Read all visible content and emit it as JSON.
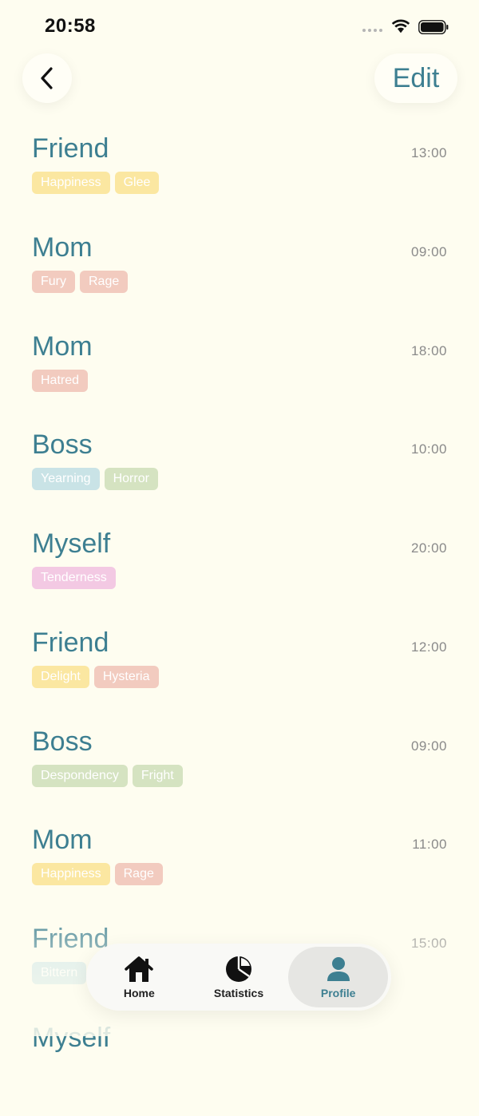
{
  "status_bar": {
    "time": "20:58"
  },
  "header": {
    "back_icon": "chevron-left-icon",
    "edit_label": "Edit"
  },
  "entries": [
    {
      "name": "Friend",
      "time": "13:00",
      "tags": [
        {
          "label": "Happiness",
          "color": "yellow"
        },
        {
          "label": "Glee",
          "color": "yellow"
        }
      ]
    },
    {
      "name": "Mom",
      "time": "09:00",
      "tags": [
        {
          "label": "Fury",
          "color": "red"
        },
        {
          "label": "Rage",
          "color": "red"
        }
      ]
    },
    {
      "name": "Mom",
      "time": "18:00",
      "tags": [
        {
          "label": "Hatred",
          "color": "red"
        }
      ]
    },
    {
      "name": "Boss",
      "time": "10:00",
      "tags": [
        {
          "label": "Yearning",
          "color": "blue"
        },
        {
          "label": "Horror",
          "color": "green"
        }
      ]
    },
    {
      "name": "Myself",
      "time": "20:00",
      "tags": [
        {
          "label": "Tenderness",
          "color": "pink"
        }
      ]
    },
    {
      "name": "Friend",
      "time": "12:00",
      "tags": [
        {
          "label": "Delight",
          "color": "yellow"
        },
        {
          "label": "Hysteria",
          "color": "red"
        }
      ]
    },
    {
      "name": "Boss",
      "time": "09:00",
      "tags": [
        {
          "label": "Despondency",
          "color": "green"
        },
        {
          "label": "Fright",
          "color": "green"
        }
      ]
    },
    {
      "name": "Mom",
      "time": "11:00",
      "tags": [
        {
          "label": "Happiness",
          "color": "yellow"
        },
        {
          "label": "Rage",
          "color": "red"
        }
      ]
    },
    {
      "name": "Friend",
      "time": "15:00",
      "tags": [
        {
          "label": "Bittern",
          "color": "blue"
        }
      ]
    },
    {
      "name": "Myself",
      "time": "",
      "tags": []
    }
  ],
  "tab_bar": {
    "tabs": [
      {
        "label": "Home",
        "icon": "home-icon",
        "active": false
      },
      {
        "label": "Statistics",
        "icon": "pie-chart-icon",
        "active": false
      },
      {
        "label": "Profile",
        "icon": "person-icon",
        "active": true
      }
    ]
  },
  "colors": {
    "background": "#fefdf0",
    "accent": "#3d7f91",
    "tag_yellow": "#fbe7a1",
    "tag_red": "#f2cbbf",
    "tag_blue": "#c9e3e6",
    "tag_green": "#d5e3c1",
    "tag_pink": "#f3c9e3"
  }
}
